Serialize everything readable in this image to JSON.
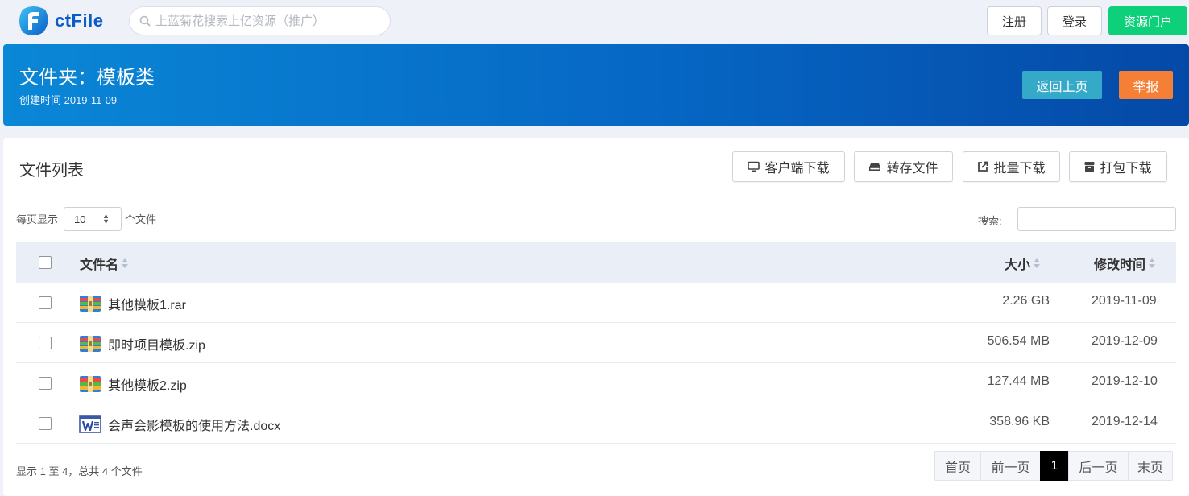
{
  "header": {
    "logo_text": "ctFile",
    "search_placeholder": "上蓝菊花搜索上亿资源（推广）",
    "register_label": "注册",
    "login_label": "登录",
    "portal_label": "资源门户",
    "portal_color": "#0fd07a"
  },
  "banner": {
    "title": "文件夹：模板类",
    "created": "创建时间 2019-11-09",
    "back_label": "返回上页",
    "report_label": "举报",
    "back_color": "#35aac8",
    "report_color": "#f57f34"
  },
  "panel": {
    "title": "文件列表",
    "toolbar": {
      "client_download": "客户端下载",
      "save_file": "转存文件",
      "batch_download": "批量下载",
      "pack_download": "打包下载"
    },
    "per_page_label": "每页显示",
    "per_page_value": "10",
    "per_page_suffix": "个文件",
    "search_label": "搜索:"
  },
  "table": {
    "columns": {
      "name": "文件名",
      "size": "大小",
      "modified": "修改时间"
    },
    "rows": [
      {
        "name": "其他模板1.rar",
        "size": "2.26 GB",
        "modified": "2019-11-09",
        "icon": "archive-icon"
      },
      {
        "name": "即时项目模板.zip",
        "size": "506.54 MB",
        "modified": "2019-12-09",
        "icon": "archive-icon"
      },
      {
        "name": "其他模板2.zip",
        "size": "127.44 MB",
        "modified": "2019-12-10",
        "icon": "archive-icon"
      },
      {
        "name": "会声会影模板的使用方法.docx",
        "size": "358.96 KB",
        "modified": "2019-12-14",
        "icon": "word-doc-icon"
      }
    ]
  },
  "footer": {
    "info": "显示 1 至 4，总共 4 个文件",
    "pagination": {
      "first": "首页",
      "prev": "前一页",
      "current": "1",
      "next": "后一页",
      "last": "末页"
    }
  }
}
